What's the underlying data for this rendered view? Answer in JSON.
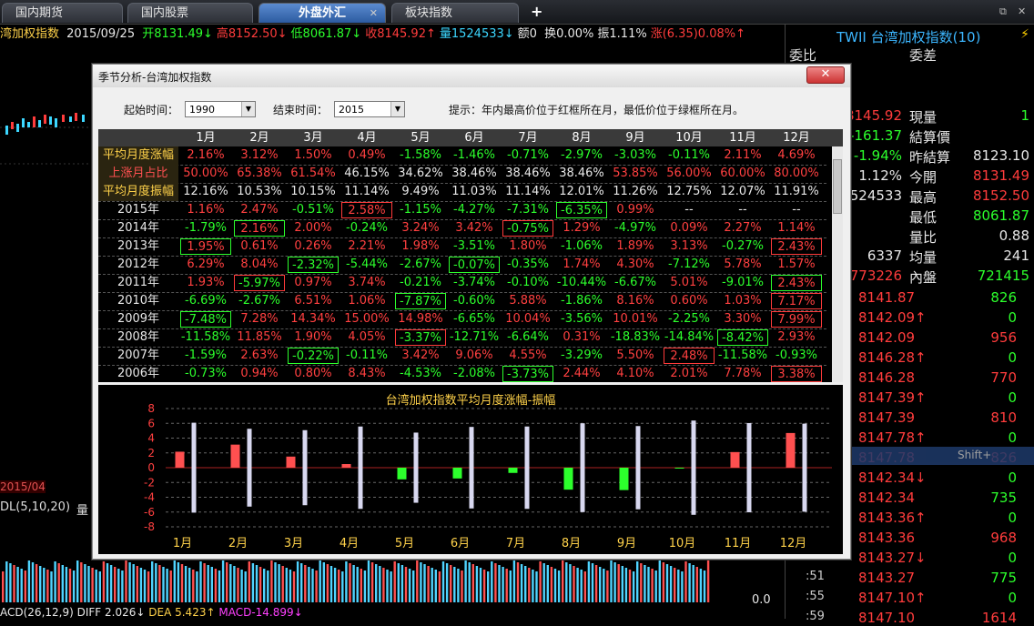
{
  "tabs": [
    {
      "label": "国内期货"
    },
    {
      "label": "国内股票"
    },
    {
      "label": "外盘外汇",
      "close": "✕"
    },
    {
      "label": "板块指数"
    }
  ],
  "add_tab": "+",
  "window_controls": {
    "restore": "⧉",
    "close": "✕"
  },
  "infobar": {
    "name": "湾加权指数",
    "date": "2015/09/25",
    "open": "开8131.49↓",
    "high": "高8152.50↓",
    "low": "低8061.87↓",
    "close": "收8145.92↑",
    "volume": "量1524533↓",
    "amount": "额0",
    "turnover": "换0.00%",
    "amplitude": "振1.11%",
    "change": "涨(6.35)0.08%↑"
  },
  "left_chart": {
    "date_label": "2015/04",
    "ma_label": "DL(5,10,20)",
    "vol_label": "量"
  },
  "statusbar": {
    "macd_name": "ACD(26,12,9)",
    "diff": "DIFF 2.026↓",
    "dea": "DEA 5.423↑",
    "macd": "MACD-14.899↓"
  },
  "zero_label": "0.0",
  "right_panel": {
    "ticker": "TWII",
    "title": "台湾加权指数(10)",
    "bolt": "⚡",
    "wei_bi": "委比",
    "wei_cha": "委差",
    "quote_rows": [
      {
        "left": "8145.92",
        "label": "現量",
        "value": "1",
        "lc": "#ff3c3c",
        "vc": "#2cff2c"
      },
      {
        "left": "-161.37",
        "label": "結算價",
        "value": "",
        "lc": "#2cff2c",
        "vc": "#e8e8e8"
      },
      {
        "left": "-1.94%",
        "label": "昨結算",
        "value": "8123.10",
        "lc": "#2cff2c",
        "vc": "#e8e8e8"
      },
      {
        "left": "1.12%",
        "label": "今開",
        "value": "8131.49",
        "lc": "#e8e8e8",
        "vc": "#ff3c3c"
      },
      {
        "left": "524533",
        "label": "最高",
        "value": "8152.50",
        "lc": "#e8e8e8",
        "vc": "#ff3c3c"
      },
      {
        "left": "",
        "label": "最低",
        "value": "8061.87",
        "lc": "#e8e8e8",
        "vc": "#2cff2c"
      },
      {
        "left": "",
        "label": "量比",
        "value": "0.88",
        "lc": "#e8e8e8",
        "vc": "#e8e8e8"
      },
      {
        "left": "6337",
        "label": "均量",
        "value": "241",
        "lc": "#e8e8e8",
        "vc": "#e8e8e8"
      },
      {
        "left": "773226",
        "label": "內盤",
        "value": "721415",
        "lc": "#ff3c3c",
        "vc": "#2cff2c"
      }
    ],
    "ticks": [
      {
        "price": "8141.87",
        "vol": "826",
        "pc": "#ff3c3c",
        "vc": "#2cff2c"
      },
      {
        "price": "8142.09↑",
        "vol": "0",
        "pc": "#ff3c3c",
        "vc": "#2cff2c"
      },
      {
        "price": "8142.09",
        "vol": "956",
        "pc": "#ff3c3c",
        "vc": "#ff3c3c"
      },
      {
        "price": "8146.28↑",
        "vol": "0",
        "pc": "#ff3c3c",
        "vc": "#2cff2c"
      },
      {
        "price": "8146.28",
        "vol": "770",
        "pc": "#ff3c3c",
        "vc": "#ff3c3c"
      },
      {
        "price": "8147.39↑",
        "vol": "0",
        "pc": "#ff3c3c",
        "vc": "#2cff2c"
      },
      {
        "price": "8147.39",
        "vol": "810",
        "pc": "#ff3c3c",
        "vc": "#ff3c3c"
      },
      {
        "price": "8147.78↑",
        "vol": "0",
        "pc": "#ff3c3c",
        "vc": "#2cff2c"
      },
      {
        "price": "8147.78",
        "vol": "826",
        "pc": "#ff3c3c",
        "vc": "#ff3c3c"
      },
      {
        "price": "8142.34↓",
        "vol": "0",
        "pc": "#ff3c3c",
        "vc": "#2cff2c"
      },
      {
        "price": "8142.34",
        "vol": "735",
        "pc": "#ff3c3c",
        "vc": "#2cff2c"
      },
      {
        "price": "8143.36↑",
        "vol": "0",
        "pc": "#ff3c3c",
        "vc": "#2cff2c"
      },
      {
        "price": "8143.36",
        "vol": "968",
        "pc": "#ff3c3c",
        "vc": "#ff3c3c"
      },
      {
        "price": "8143.27↓",
        "vol": "0",
        "pc": "#ff3c3c",
        "vc": "#2cff2c"
      },
      {
        "price": "8143.27",
        "vol": "775",
        "pc": "#ff3c3c",
        "vc": "#2cff2c"
      },
      {
        "price": "8147.10↑",
        "vol": "0",
        "pc": "#ff3c3c",
        "vc": "#2cff2c"
      },
      {
        "price": "8147.10",
        "vol": "1614",
        "pc": "#ff3c3c",
        "vc": "#ff3c3c"
      }
    ],
    "tick_times": [
      ":51",
      ":55",
      ":59"
    ],
    "hotkey_hint": "Shift+"
  },
  "dialog": {
    "title": "季节分析-台湾加权指数",
    "close": "✕",
    "start_label": "起始时间：",
    "start_value": "1990",
    "end_label": "结束时间：",
    "end_value": "2015",
    "hint": "提示：年内最高价位于红框所在月，最低价位于绿框所在月。",
    "months": [
      "1月",
      "2月",
      "3月",
      "4月",
      "5月",
      "6月",
      "7月",
      "8月",
      "9月",
      "10月",
      "11月",
      "12月"
    ],
    "summary_rows": [
      {
        "label": "平均月度涨幅",
        "vals": [
          "2.16%",
          "3.12%",
          "1.50%",
          "0.49%",
          "-1.58%",
          "-1.46%",
          "-0.71%",
          "-2.97%",
          "-3.03%",
          "-0.11%",
          "2.11%",
          "4.69%"
        ]
      },
      {
        "label": "上涨月占比",
        "vals": [
          "50.00%",
          "65.38%",
          "61.54%",
          "46.15%",
          "34.62%",
          "38.46%",
          "38.46%",
          "38.46%",
          "53.85%",
          "56.00%",
          "60.00%",
          "80.00%"
        ]
      },
      {
        "label": "平均月度振幅",
        "vals": [
          "12.16%",
          "10.53%",
          "10.15%",
          "11.14%",
          "9.49%",
          "11.03%",
          "11.14%",
          "12.01%",
          "11.26%",
          "12.75%",
          "12.07%",
          "11.91%"
        ]
      }
    ],
    "year_rows": [
      {
        "label": "2015年",
        "vals": [
          "1.16%",
          "2.47%",
          "-0.51%",
          "2.58%",
          "-1.15%",
          "-4.27%",
          "-7.31%",
          "-6.35%",
          "0.99%",
          "--",
          "--",
          "--"
        ],
        "hi": 3,
        "lo": 7
      },
      {
        "label": "2014年",
        "vals": [
          "-1.79%",
          "2.16%",
          "2.00%",
          "-0.24%",
          "3.24%",
          "3.42%",
          "-0.75%",
          "1.29%",
          "-4.97%",
          "0.09%",
          "2.27%",
          "1.14%"
        ],
        "hi": 6,
        "lo": 1
      },
      {
        "label": "2013年",
        "vals": [
          "1.95%",
          "0.61%",
          "0.26%",
          "2.21%",
          "1.98%",
          "-3.51%",
          "1.80%",
          "-1.06%",
          "1.89%",
          "3.13%",
          "-0.27%",
          "2.43%"
        ],
        "hi": 11,
        "lo": 0
      },
      {
        "label": "2012年",
        "vals": [
          "6.29%",
          "8.04%",
          "-2.32%",
          "-5.44%",
          "-2.67%",
          "-0.07%",
          "-0.35%",
          "1.74%",
          "4.30%",
          "-7.12%",
          "5.78%",
          "1.57%"
        ],
        "hi": -1,
        "lo": 5,
        "lo2": 2
      },
      {
        "label": "2011年",
        "vals": [
          "1.93%",
          "-5.97%",
          "0.97%",
          "3.74%",
          "-0.21%",
          "-3.74%",
          "-0.10%",
          "-10.44%",
          "-6.67%",
          "5.01%",
          "-9.01%",
          "2.43%"
        ],
        "hi": 1,
        "lo": 11
      },
      {
        "label": "2010年",
        "vals": [
          "-6.69%",
          "-2.67%",
          "6.51%",
          "1.06%",
          "-7.87%",
          "-0.60%",
          "5.88%",
          "-1.86%",
          "8.16%",
          "0.60%",
          "1.03%",
          "7.17%"
        ],
        "hi": 11,
        "lo": 4
      },
      {
        "label": "2009年",
        "vals": [
          "-7.48%",
          "7.28%",
          "14.34%",
          "15.00%",
          "14.98%",
          "-6.65%",
          "10.04%",
          "-3.56%",
          "10.01%",
          "-2.25%",
          "3.30%",
          "7.99%"
        ],
        "hi": 11,
        "lo": 0
      },
      {
        "label": "2008年",
        "vals": [
          "-11.58%",
          "11.85%",
          "1.90%",
          "4.05%",
          "-3.37%",
          "-12.71%",
          "-6.64%",
          "0.31%",
          "-18.83%",
          "-14.84%",
          "-8.42%",
          "2.93%"
        ],
        "hi": 4,
        "lo": 10
      },
      {
        "label": "2007年",
        "vals": [
          "-1.59%",
          "2.63%",
          "-0.22%",
          "-0.11%",
          "3.42%",
          "9.06%",
          "4.55%",
          "-3.29%",
          "5.50%",
          "2.48%",
          "-11.58%",
          "-0.93%"
        ],
        "hi": 9,
        "lo": 2
      },
      {
        "label": "2006年",
        "vals": [
          "-0.73%",
          "0.94%",
          "0.80%",
          "8.43%",
          "-4.53%",
          "-2.08%",
          "-3.73%",
          "2.44%",
          "4.10%",
          "2.01%",
          "7.78%",
          "3.38%"
        ],
        "hi": 11,
        "lo": 6
      }
    ]
  },
  "chart_data": {
    "type": "bar",
    "title": "台湾加权指数平均月度涨幅-振幅",
    "categories": [
      "1月",
      "2月",
      "3月",
      "4月",
      "5月",
      "6月",
      "7月",
      "8月",
      "9月",
      "10月",
      "11月",
      "12月"
    ],
    "ylim": [
      -8,
      8
    ],
    "yticks": [
      "8",
      "6",
      "4",
      "2",
      "0",
      "-2",
      "-4",
      "-6",
      "-8"
    ],
    "series": [
      {
        "values": [
          2.16,
          3.12,
          1.5,
          0.49,
          -1.58,
          -1.46,
          -0.71,
          -2.97,
          -3.03,
          -0.11,
          2.11,
          4.69
        ],
        "pos_color": "#ff5050",
        "neg_color": "#2cff2c"
      },
      {
        "values": [
          12.16,
          10.53,
          10.15,
          11.14,
          9.49,
          11.03,
          11.14,
          12.01,
          11.26,
          12.75,
          12.07,
          11.91
        ],
        "color": "#d8d8f0"
      }
    ],
    "grid": true
  }
}
